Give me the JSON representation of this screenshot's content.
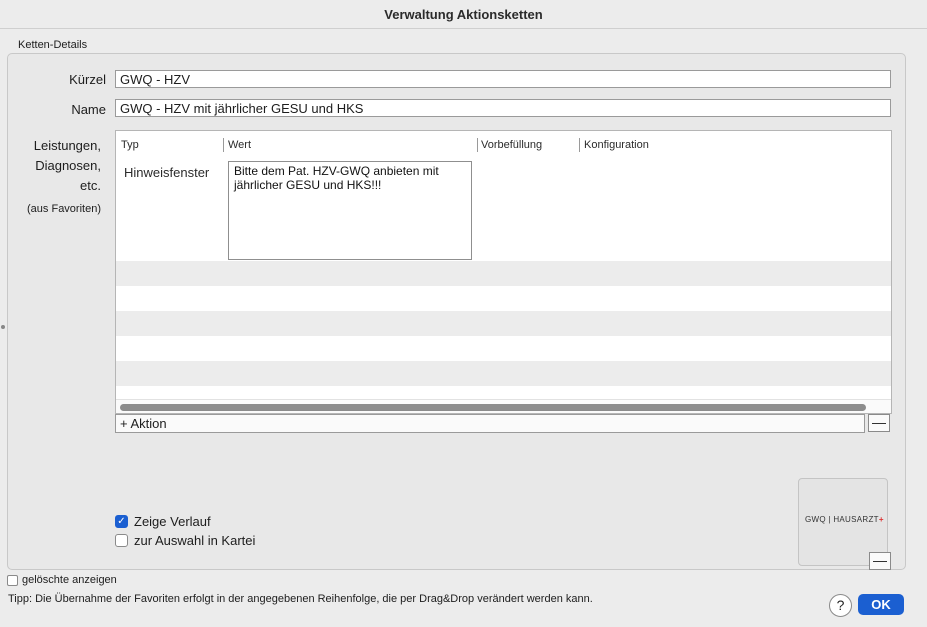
{
  "window": {
    "title": "Verwaltung Aktionsketten"
  },
  "group": {
    "label": "Ketten-Details"
  },
  "form": {
    "kuerzel_label": "Kürzel",
    "kuerzel_value": "GWQ - HZV",
    "name_label": "Name",
    "name_value": "GWQ - HZV mit jährlicher GESU und HKS",
    "leistungen_label_1": "Leistungen,",
    "leistungen_label_2": "Diagnosen,",
    "leistungen_label_3": "etc.",
    "favoriten_note": "(aus Favoriten)"
  },
  "table": {
    "columns": [
      "Typ",
      "Wert",
      "Vorbefüllung",
      "Konfiguration"
    ],
    "rows": [
      {
        "typ": "Hinweisfenster",
        "wert": "Bitte dem Pat. HZV-GWQ anbieten mit jährlicher GESU und HKS!!!",
        "vorbefuellung": "",
        "konfiguration": ""
      }
    ]
  },
  "toolbar": {
    "add_action_label": "+ Aktion",
    "remove_label": "—"
  },
  "options": {
    "zeige_verlauf_label": "Zeige Verlauf",
    "zeige_verlauf_checked": true,
    "zur_auswahl_label": "zur Auswahl in Kartei",
    "zur_auswahl_checked": false
  },
  "logo": {
    "left": "GWQ",
    "right": "HAUSARZT"
  },
  "footer": {
    "geloschte_label": "gelöschte anzeigen",
    "tip": "Tipp: Die Übernahme der Favoriten erfolgt in der angegebenen Reihenfolge, die per Drag&Drop verändert werden kann.",
    "help_label": "?",
    "ok_label": "OK"
  },
  "colors": {
    "accent": "#1b5fd1",
    "stripe": "#ececec",
    "background": "#ececec"
  }
}
